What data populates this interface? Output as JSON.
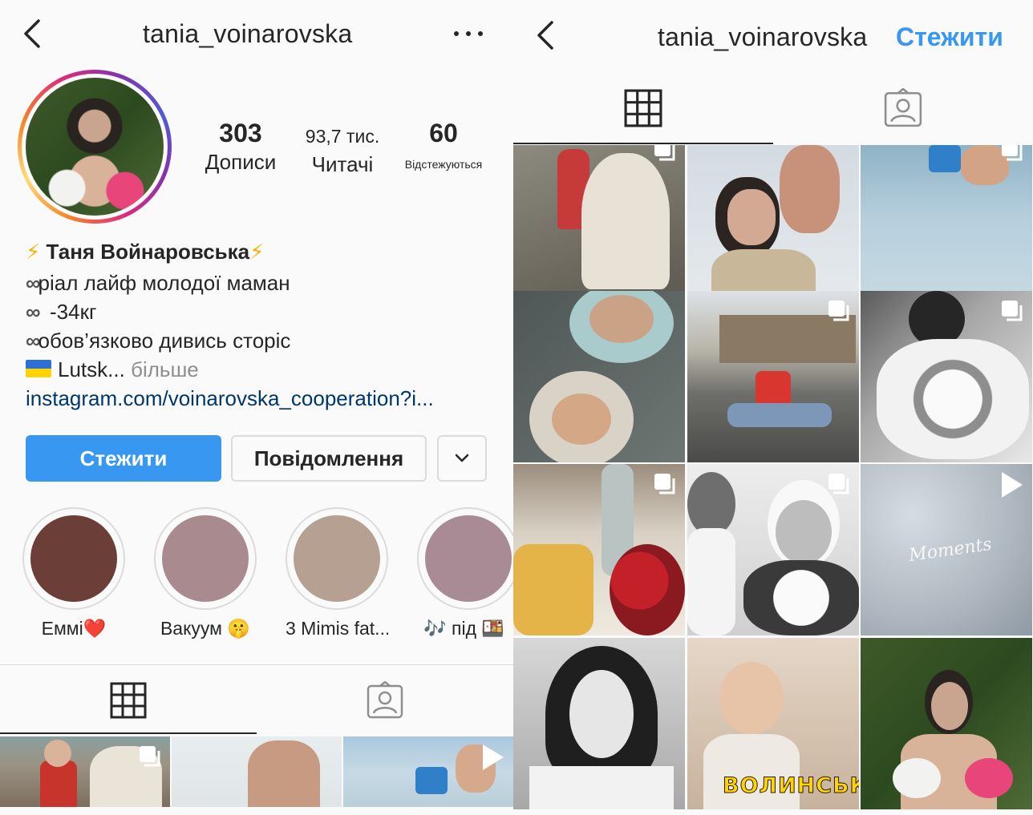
{
  "profile": {
    "username": "tania_voinarovska",
    "stats": {
      "posts_count": "303",
      "posts_label": "Дописи",
      "followers_count": "93,7 тис.",
      "followers_label": "Читачі",
      "following_count": "60",
      "following_label": "Відстежуються"
    },
    "bio": {
      "name": "Таня Войнаровська",
      "lines": [
        "ріал лайф молодої маман",
        "-34кг",
        "обов’язково дивись сторіс"
      ],
      "location": "Lutsk...",
      "more_label": "більше",
      "link": "instagram.com/voinarovska_cooperation?i..."
    },
    "buttons": {
      "follow": "Стежити",
      "message": "Повідомлення"
    },
    "highlights": [
      {
        "label": "Еммі❤️",
        "color": "#6b3f37"
      },
      {
        "label": "Вакуум 🤫",
        "color": "#a98a8e"
      },
      {
        "label": "3 Mimis fat...",
        "color": "#b5a092"
      },
      {
        "label": "🎶 під 🍱",
        "color": "#a88b95"
      }
    ]
  },
  "right_header": {
    "username": "tania_voinarovska",
    "follow_label": "Стежити"
  },
  "grid_overlay": {
    "cloud_text": "Moments",
    "news_banner": "ВОЛИНСЬКІ НОВИНИ"
  },
  "icons": {
    "back": "chevron-left-icon",
    "more": "more-dots-icon",
    "grid": "grid-icon",
    "tagged": "tagged-person-icon",
    "multi": "carousel-icon",
    "video": "play-icon",
    "dropdown": "chevron-down-icon"
  },
  "colors": {
    "follow_button": "#3897f0",
    "link": "#00376b",
    "muted": "#8e8e8e"
  }
}
